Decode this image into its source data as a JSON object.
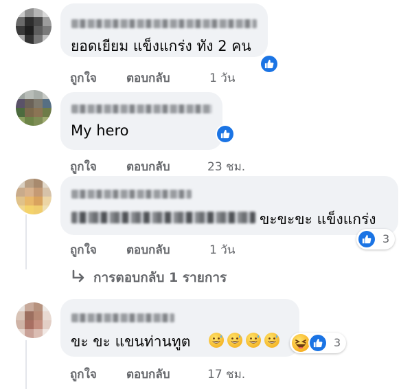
{
  "comments": [
    {
      "text": "ยอดเยียม แข็งแกร่ง ทัง 2 คน",
      "actions": {
        "like": "ถูกใจ",
        "reply": "ตอบกลับ",
        "time": "1 วัน"
      },
      "reaction_count": ""
    },
    {
      "text": "My hero",
      "actions": {
        "like": "ถูกใจ",
        "reply": "ตอบกลับ",
        "time": "23 ชม."
      },
      "reaction_count": ""
    },
    {
      "text": "ขะขะขะ แข็งแกร่ง",
      "actions": {
        "like": "ถูกใจ",
        "reply": "ตอบกลับ",
        "time": "1 วัน"
      },
      "reaction_count": "3",
      "replies_link": "การตอบกลับ 1 รายการ"
    },
    {
      "text": "ขะ ขะ แขนท่านทูต",
      "actions": {
        "like": "ถูกใจ",
        "reply": "ตอบกลับ",
        "time": "17 ชม."
      },
      "reaction_count": "3"
    }
  ],
  "icons": {
    "like": "thumbs-up-icon",
    "haha": "haha-reaction-icon",
    "reply_arrow": "reply-arrow-icon",
    "grin_sweat": "grinning-sweat-emoji"
  },
  "colors": {
    "bubble": "#f0f2f5",
    "like_blue": "#1b74e4",
    "action_gray": "#65676b"
  }
}
